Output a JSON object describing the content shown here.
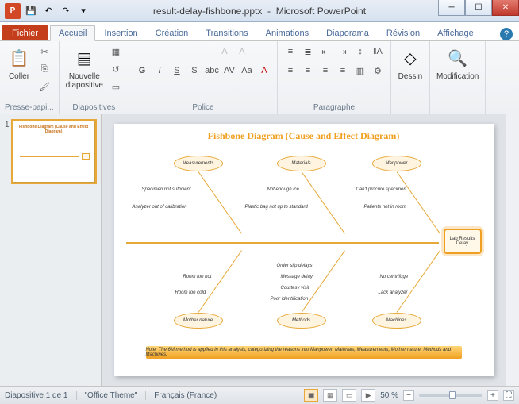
{
  "window": {
    "filename": "result-delay-fishbone.pptx",
    "app": "Microsoft PowerPoint"
  },
  "tabs": {
    "file": "Fichier",
    "items": [
      "Accueil",
      "Insertion",
      "Création",
      "Transitions",
      "Animations",
      "Diaporama",
      "Révision",
      "Affichage"
    ],
    "active_index": 0
  },
  "ribbon": {
    "clipboard": {
      "label": "Presse-papi...",
      "paste": "Coller"
    },
    "slides": {
      "label": "Diapositives",
      "new_slide": "Nouvelle\ndiapositive"
    },
    "font": {
      "label": "Police"
    },
    "paragraph": {
      "label": "Paragraphe"
    },
    "drawing": {
      "label": "Dessin"
    },
    "editing": {
      "label": "Modification"
    }
  },
  "slide": {
    "number": "1",
    "title": "Fishbone Diagram (Cause and Effect Diagram)",
    "head": "Lab Results Delay",
    "categories_top": [
      "Measurements",
      "Materials",
      "Manpower"
    ],
    "categories_bottom": [
      "Mother nature",
      "Methods",
      "Machines"
    ],
    "causes": {
      "measurements": [
        "Specimen not sufficient",
        "Analyzer out of calibration"
      ],
      "materials": [
        "Not enough ice",
        "Plastic bag not up to standard"
      ],
      "manpower": [
        "Can't procure specimen",
        "Patients not in room"
      ],
      "mother_nature": [
        "Room too hot",
        "Room too cold"
      ],
      "methods": [
        "Order slip delays",
        "Message delay",
        "Courtesy visit",
        "Poor identification"
      ],
      "machines": [
        "No centrifuge",
        "Lack analyzer"
      ]
    },
    "note": "Note: The 6M method is applied in this analysis, categorizing the reasons into Manpower, Materials, Measurements, Mother nature, Methods and Machines."
  },
  "status": {
    "slide_info": "Diapositive 1 de 1",
    "theme": "\"Office Theme\"",
    "language": "Français (France)",
    "zoom": "50 %"
  },
  "chart_data": {
    "type": "fishbone",
    "effect": "Lab Results Delay",
    "categories": [
      {
        "name": "Measurements",
        "position": "top",
        "causes": [
          "Specimen not sufficient",
          "Analyzer out of calibration"
        ]
      },
      {
        "name": "Materials",
        "position": "top",
        "causes": [
          "Not enough ice",
          "Plastic bag not up to standard"
        ]
      },
      {
        "name": "Manpower",
        "position": "top",
        "causes": [
          "Can't procure specimen",
          "Patients not in room"
        ]
      },
      {
        "name": "Mother nature",
        "position": "bottom",
        "causes": [
          "Room too hot",
          "Room too cold"
        ]
      },
      {
        "name": "Methods",
        "position": "bottom",
        "causes": [
          "Order slip delays",
          "Message delay",
          "Courtesy visit",
          "Poor identification"
        ]
      },
      {
        "name": "Machines",
        "position": "bottom",
        "causes": [
          "No centrifuge",
          "Lack analyzer"
        ]
      }
    ],
    "title": "Fishbone Diagram (Cause and Effect Diagram)"
  }
}
